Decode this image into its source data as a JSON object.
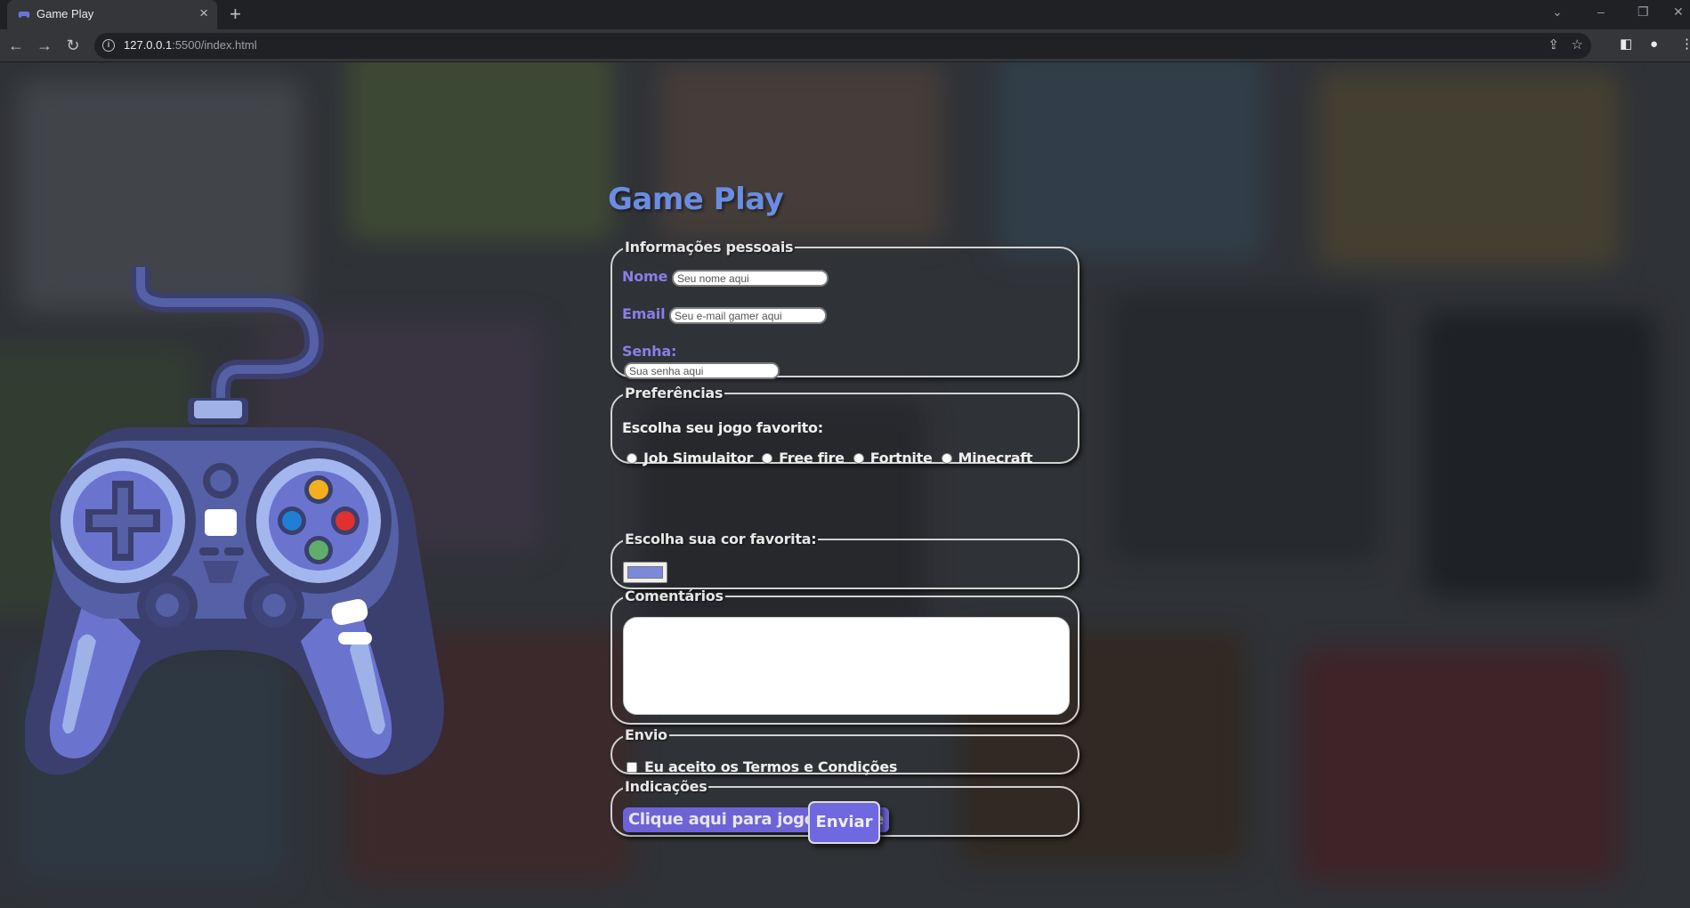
{
  "browser": {
    "tab_title": "Game Play",
    "url_host": "127.0.0.1",
    "url_rest": ":5500/index.html"
  },
  "page": {
    "title": "Game Play"
  },
  "personal": {
    "legend": "Informações pessoais",
    "name_label": "Nome",
    "name_placeholder": "Seu nome aqui",
    "email_label": "Email",
    "email_placeholder": "Seu e-mail gamer aqui",
    "password_label": "Senha:",
    "password_placeholder": "Sua senha aqui"
  },
  "preferences": {
    "legend": "Preferências",
    "prompt": "Escolha seu jogo favorito:",
    "options": [
      "Job Simulaitor",
      "Free fire",
      "Fortnite",
      "Minecraft"
    ]
  },
  "color": {
    "legend": "Escolha sua cor favorita:",
    "value": "#7a8ad8"
  },
  "comments": {
    "legend": "Comentários"
  },
  "send": {
    "legend": "Envio",
    "terms_label": "Eu aceito os Termos e Condições"
  },
  "indications": {
    "legend": "Indicações",
    "link_label": "Clique aqui para jogos online"
  },
  "submit": {
    "label": "Enviar"
  },
  "colors": {
    "title": "#6a8ce3",
    "label": "#8a7ee6",
    "button": "#6f68e0"
  }
}
